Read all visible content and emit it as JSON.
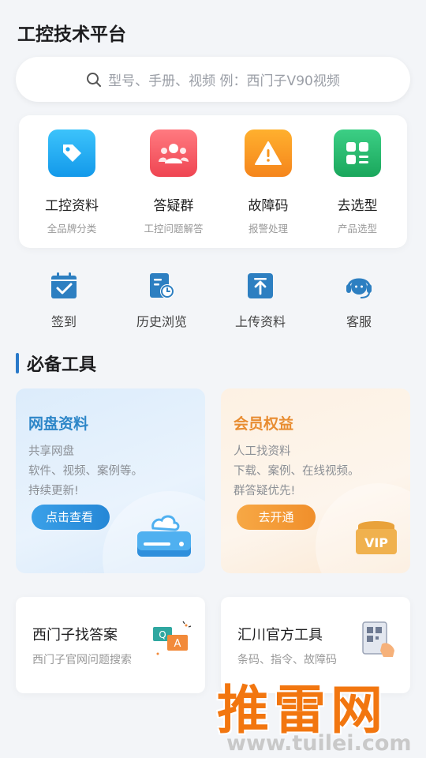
{
  "app": {
    "title": "工控技术平台"
  },
  "search": {
    "placeholder": "型号、手册、视频 例：西门子V90视频"
  },
  "categories": [
    {
      "label": "工控资料",
      "sub": "全品牌分类",
      "icon": "tag-icon",
      "color": "#1aa3f0"
    },
    {
      "label": "答疑群",
      "sub": "工控问题解答",
      "icon": "group-icon",
      "color": "#f2545b"
    },
    {
      "label": "故障码",
      "sub": "报警处理",
      "icon": "warning-icon",
      "color": "#f7941d"
    },
    {
      "label": "去选型",
      "sub": "产品选型",
      "icon": "grid-icon",
      "color": "#21b36b"
    }
  ],
  "quick_actions": [
    {
      "label": "签到",
      "icon": "calendar-check-icon"
    },
    {
      "label": "历史浏览",
      "icon": "history-doc-icon"
    },
    {
      "label": "上传资料",
      "icon": "upload-icon"
    },
    {
      "label": "客服",
      "icon": "headset-icon"
    }
  ],
  "section": {
    "title": "必备工具"
  },
  "promos": {
    "netdisk": {
      "title": "网盘资料",
      "lines": [
        "共享网盘",
        "软件、视频、案例等。",
        "持续更新!"
      ],
      "button": "点击查看"
    },
    "vip": {
      "title": "会员权益",
      "lines": [
        "人工找资料",
        "下载、案例、在线视频。",
        "群答疑优先!"
      ],
      "button": "去开通",
      "badge": "VIP"
    }
  },
  "tools": [
    {
      "title": "西门子找答案",
      "sub": "西门子官网问题搜索",
      "icon": "qa-chat-icon"
    },
    {
      "title": "汇川官方工具",
      "sub": "条码、指令、故障码",
      "icon": "qr-scan-icon"
    }
  ],
  "watermark": {
    "text": "推雷网",
    "url": "www.tuilei.com"
  },
  "colors": {
    "accent": "#2979c9",
    "brand_orange": "#f2760f"
  }
}
